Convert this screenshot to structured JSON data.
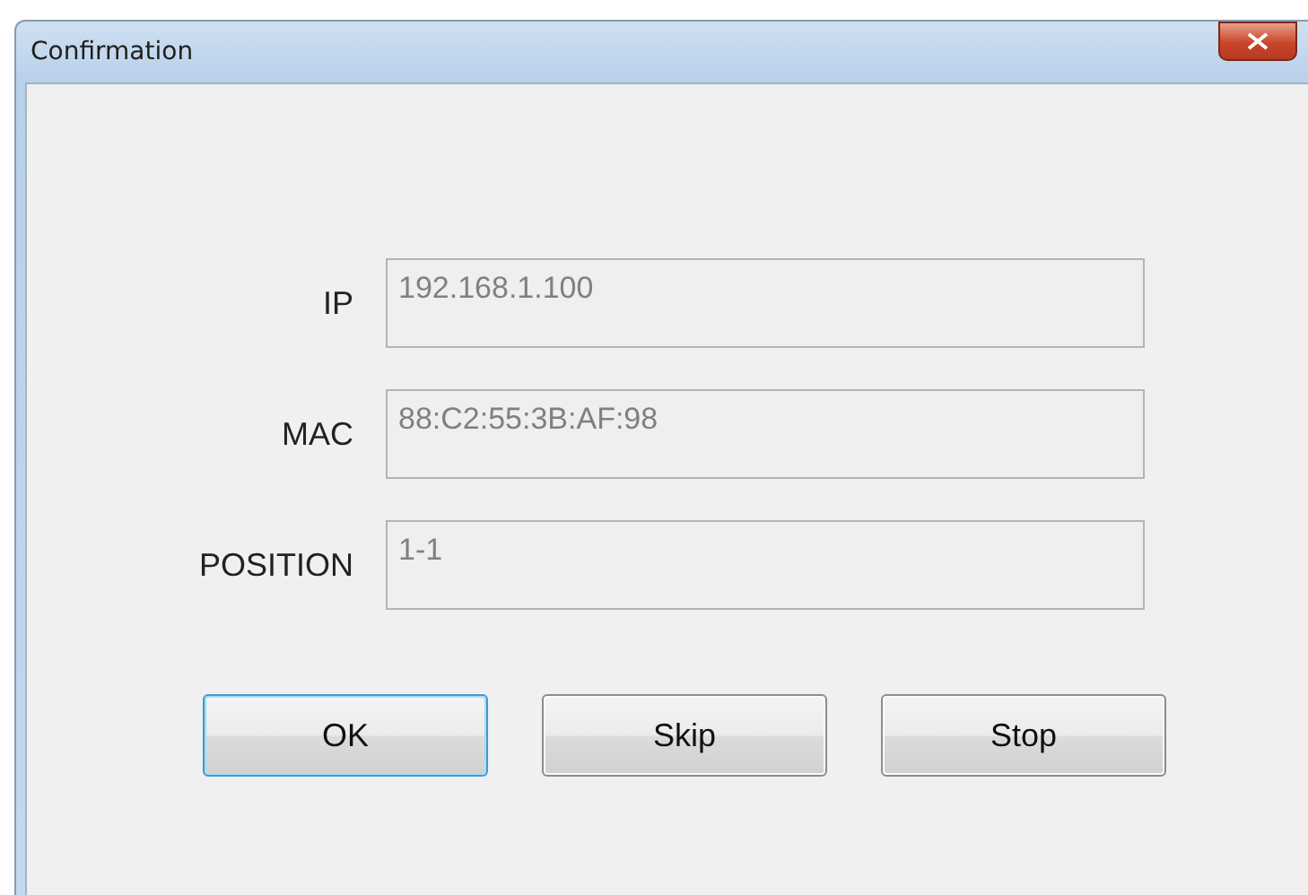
{
  "window": {
    "title": "Confirmation"
  },
  "fields": [
    {
      "label": "IP",
      "value": "192.168.1.100"
    },
    {
      "label": "MAC",
      "value": "88:C2:55:3B:AF:98"
    },
    {
      "label": "POSITION",
      "value": "1-1"
    }
  ],
  "buttons": [
    {
      "label": "OK",
      "focused": true
    },
    {
      "label": "Skip",
      "focused": false
    },
    {
      "label": "Stop",
      "focused": false
    }
  ]
}
